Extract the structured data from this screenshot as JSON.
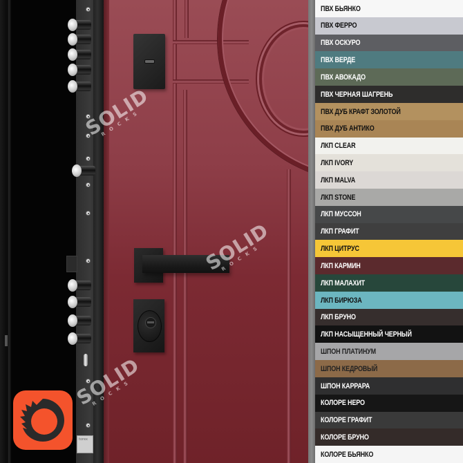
{
  "image": {
    "subject": "Red steel entrance door with black hardware and color options list",
    "watermark_text": "SOLID",
    "watermark_subtext": "ROCKS",
    "badge_icon": "corona-renderer-logo-icon",
    "lock_plate_text": "torex"
  },
  "colors": {
    "door": "#8e3e48",
    "hardware": "#1f1f1f",
    "logo_bg": "#f4532c",
    "frame": "#7f7f7f"
  },
  "swatches": [
    {
      "label": "ПВХ БЬЯНКО",
      "bg": "#f7f7f7",
      "fg": "#111111"
    },
    {
      "label": "ПВХ ФЕРРО",
      "bg": "#c8c9d0",
      "fg": "#111111"
    },
    {
      "label": "ПВХ ОСКУРО",
      "bg": "#5d5e62",
      "fg": "#ffffff"
    },
    {
      "label": "ПВХ ВЕРДЕ",
      "bg": "#4f7b80",
      "fg": "#ffffff"
    },
    {
      "label": "ПВХ АВОКАДО",
      "bg": "#5d6a57",
      "fg": "#ffffff"
    },
    {
      "label": "ПВХ ЧЕРНАЯ ШАГРЕНЬ",
      "bg": "#2e2d2c",
      "fg": "#ffffff"
    },
    {
      "label": "ПВХ ДУБ КРАФТ ЗОЛОТОЙ",
      "bg": "#b3915f",
      "fg": "#111111"
    },
    {
      "label": "ПВХ ДУБ АНТИКО",
      "bg": "#a98555",
      "fg": "#111111"
    },
    {
      "label": "ЛКП CLEAR",
      "bg": "#f2f2ee",
      "fg": "#111111"
    },
    {
      "label": "ЛКП IVORY",
      "bg": "#e4e1da",
      "fg": "#111111"
    },
    {
      "label": "ЛКП MALVA",
      "bg": "#dcd8d5",
      "fg": "#111111"
    },
    {
      "label": "ЛКП STONE",
      "bg": "#a9a9a7",
      "fg": "#111111"
    },
    {
      "label": "ЛКП МУССОН",
      "bg": "#464849",
      "fg": "#ffffff"
    },
    {
      "label": "ЛКП ГРАФИТ",
      "bg": "#3f3f3f",
      "fg": "#ffffff"
    },
    {
      "label": "ЛКП ЦИТРУС",
      "bg": "#f6c637",
      "fg": "#111111"
    },
    {
      "label": "ЛКП КАРМИН",
      "bg": "#5b2a2d",
      "fg": "#ffffff"
    },
    {
      "label": "ЛКП МАЛАХИТ",
      "bg": "#27473b",
      "fg": "#ffffff"
    },
    {
      "label": "ЛКП БИРЮЗА",
      "bg": "#6cb6c0",
      "fg": "#111111"
    },
    {
      "label": "ЛКП БРУНО",
      "bg": "#362e2d",
      "fg": "#ffffff"
    },
    {
      "label": "ЛКП НАСЫЩЕННЫЙ ЧЕРНЫЙ",
      "bg": "#121212",
      "fg": "#ffffff"
    },
    {
      "label": "ШПОН ПЛАТИНУМ",
      "bg": "#a6a6a8",
      "fg": "#222222"
    },
    {
      "label": "ШПОН КЕДРОВЫЙ",
      "bg": "#8c6a48",
      "fg": "#222222"
    },
    {
      "label": "ШПОН КАРРАРА",
      "bg": "#2f2f30",
      "fg": "#ffffff"
    },
    {
      "label": "КОЛОРЕ НЕРО",
      "bg": "#161616",
      "fg": "#ffffff"
    },
    {
      "label": "КОЛОРЕ ГРАФИТ",
      "bg": "#3a3a3a",
      "fg": "#ffffff"
    },
    {
      "label": "КОЛОРЕ БРУНО",
      "bg": "#342b29",
      "fg": "#ffffff"
    },
    {
      "label": "КОЛОРЕ БЬЯНКО",
      "bg": "#f5f5f5",
      "fg": "#111111"
    }
  ]
}
